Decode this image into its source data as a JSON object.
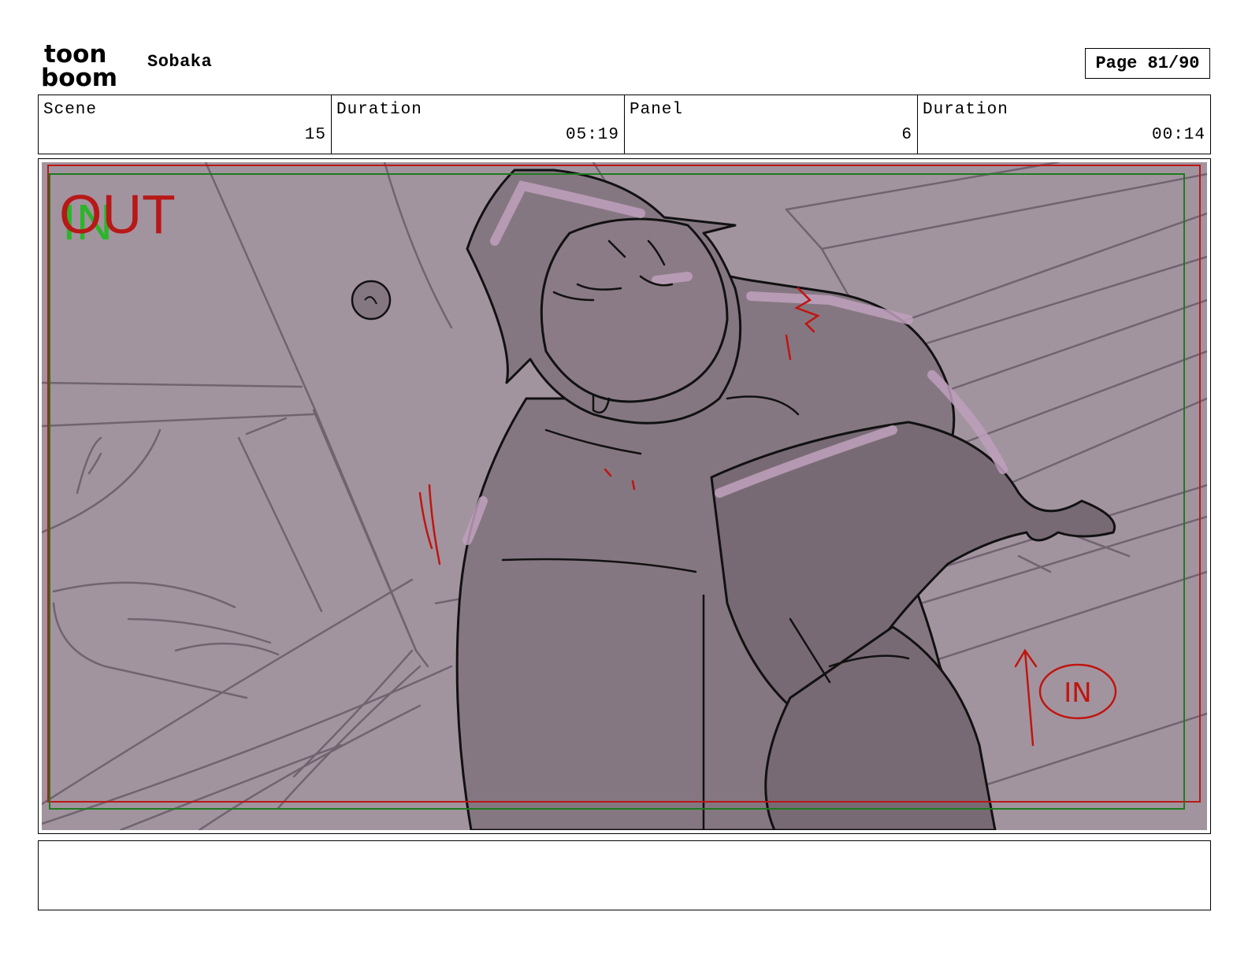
{
  "header": {
    "logo_top": "toon",
    "logo_bottom": "boom",
    "project_title": "Sobaka",
    "page_label": "Page 81/90"
  },
  "info": {
    "scene_label": "Scene",
    "scene_value": "15",
    "scene_duration_label": "Duration",
    "scene_duration_value": "05:19",
    "panel_label": "Panel",
    "panel_value": "6",
    "panel_duration_label": "Duration",
    "panel_duration_value": "00:14"
  },
  "panel": {
    "marker_out": "OUT",
    "marker_in": "IN",
    "arrow_note": "IN"
  },
  "notes": {
    "text": ""
  },
  "colors": {
    "background_fill": "#a2949f",
    "character_fill": "#857781",
    "character_dark": "#786a74",
    "highlight": "#bfa0bd",
    "red_mark": "#c0150f",
    "green_mark": "#2ab52a",
    "safe_frame_red": "#b81818",
    "safe_frame_green": "#1e7a1e"
  }
}
